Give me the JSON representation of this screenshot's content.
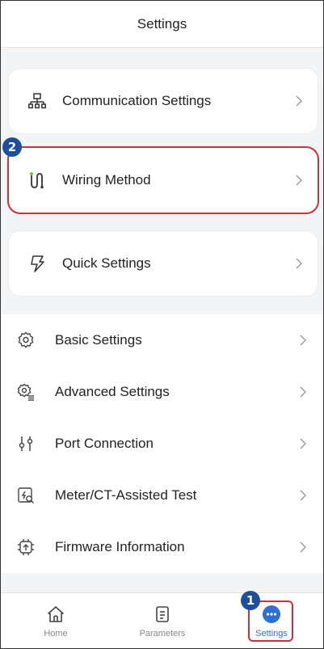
{
  "header": {
    "title": "Settings"
  },
  "cards": [
    {
      "label": "Communication Settings",
      "icon": "network-icon"
    },
    {
      "label": "Wiring Method",
      "icon": "wiring-icon"
    },
    {
      "label": "Quick Settings",
      "icon": "lightning-icon"
    }
  ],
  "list": [
    {
      "label": "Basic Settings",
      "icon": "gear-icon"
    },
    {
      "label": "Advanced Settings",
      "icon": "advanced-gear-icon"
    },
    {
      "label": "Port Connection",
      "icon": "port-icon"
    },
    {
      "label": "Meter/CT-Assisted Test",
      "icon": "meter-test-icon"
    },
    {
      "label": "Firmware Information",
      "icon": "chip-icon"
    }
  ],
  "tabs": [
    {
      "label": "Home",
      "icon": "home-icon"
    },
    {
      "label": "Parameters",
      "icon": "document-icon"
    },
    {
      "label": "Settings",
      "icon": "more-icon"
    }
  ],
  "annotations": {
    "badge_1": "1",
    "badge_2": "2"
  },
  "colors": {
    "accent": "#2f6ed6",
    "highlight": "#c7323b",
    "badge": "#1f4f9c",
    "wiring_green": "#7ec04a"
  }
}
